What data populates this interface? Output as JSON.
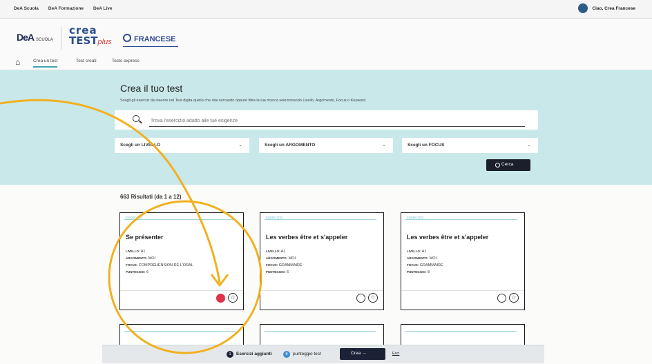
{
  "topbar": {
    "links": [
      "DeA Scuola",
      "DeA Formazione",
      "DeA Live"
    ],
    "user_label": "Ciao, Crea Francese"
  },
  "brand": {
    "dea_logo": "DeA",
    "dea_sub": "SCUOLA",
    "crea_line1": "crea",
    "crea_line2": "TEST",
    "crea_plus": "plus",
    "subject": "FRANCESE"
  },
  "nav": {
    "tabs": [
      "Crea un test",
      "Test creati",
      "Tests express"
    ],
    "active_index": 0
  },
  "search_panel": {
    "title": "Crea il tuo test",
    "subtitle": "Scegli gli esercizi da inserire nel Test digita quello che stai cercando oppure filtra la tua ricerca selezionando Livello, Argomento, Focus o Keyword.",
    "search_placeholder": "Trova l'esercizio adatto alle tue esigenze",
    "selects": [
      "Scegli un LIVELLO",
      "Scegli un ARGOMENTO",
      "Scegli un FOCUS"
    ],
    "search_button": "Cerca"
  },
  "results": {
    "count_label": "663 Risultati (da 1 a 12)",
    "cards": [
      {
        "type": "ESERCIZIO",
        "title": "Se présenter",
        "livello": "A1",
        "argomento": "MOI",
        "focus": "COMPRÉHENSION DE L'ORAL",
        "punteggio": "6",
        "added": true
      },
      {
        "type": "ESERCIZIO",
        "title": "Les verbes être et s'appeler",
        "livello": "A1",
        "argomento": "MOI",
        "focus": "GRAMMAIRE",
        "punteggio": "6",
        "added": false
      },
      {
        "type": "ESERCIZIO",
        "title": "Les verbes être et s'appeler",
        "livello": "A1",
        "argomento": "MOI",
        "focus": "GRAMMAIRE",
        "punteggio": "8",
        "added": false
      }
    ],
    "meta_labels": {
      "livello": "LIVELLO:",
      "argomento": "ARGOMENTO:",
      "focus": "FOCUS:",
      "punteggio": "PUNTEGGIO:"
    }
  },
  "bottombar": {
    "added_count": "1",
    "added_label": "Esercizi aggiunti",
    "score_count": "6",
    "score_label": "punteggio test",
    "create_button": "Crea →",
    "logout": "Esci"
  },
  "colors": {
    "accent": "#3aa6b5",
    "panel": "#c9e8ea",
    "annotation": "#f2b01e",
    "added": "#e0324a"
  }
}
